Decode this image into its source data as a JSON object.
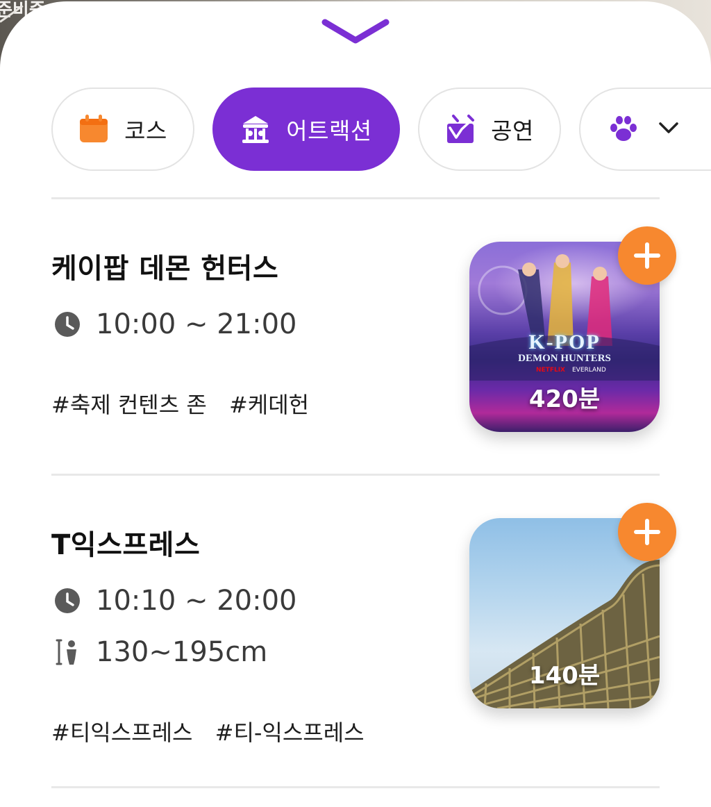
{
  "background": {
    "partial_text": "준비중"
  },
  "sheet": {
    "collapse_icon": "chevron-down-icon"
  },
  "categories": [
    {
      "label": "코스",
      "icon": "calendar-icon",
      "color": "#f7882f",
      "active": false
    },
    {
      "label": "어트랙션",
      "icon": "carousel-icon",
      "color": "#ffffff",
      "active": true
    },
    {
      "label": "공연",
      "icon": "stage-icon",
      "color": "#7b2fd4",
      "active": false
    },
    {
      "label": "",
      "icon": "paw-icon",
      "color": "#7b2fd4",
      "active": false
    }
  ],
  "colors": {
    "accent": "#7b2fd4",
    "add_button": "#f7882f"
  },
  "attractions": [
    {
      "title": "케이팝 데몬 헌터스",
      "hours": "10:00 ~ 21:00",
      "tags": [
        "#축제 컨텐츠 존",
        "#케데헌"
      ],
      "duration": "420분",
      "image_text": {
        "line1": "K-POP",
        "line2": "DEMON HUNTERS",
        "brand": "NETFLIX",
        "partner": "EVERLAND"
      }
    },
    {
      "title": "T익스프레스",
      "hours": "10:10 ~ 20:00",
      "height_limit": "130~195cm",
      "tags": [
        "#티익스프레스",
        "#티-익스프레스"
      ],
      "duration": "140분"
    }
  ]
}
